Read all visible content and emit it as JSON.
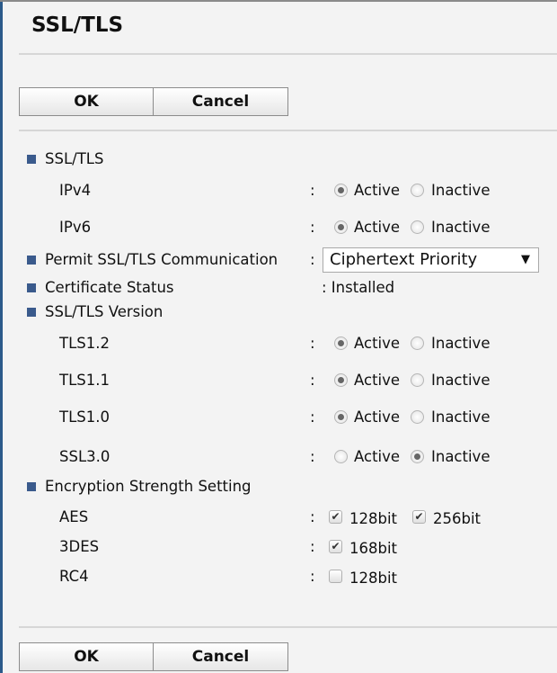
{
  "title": "SSL/TLS",
  "buttons": {
    "ok": "OK",
    "cancel": "Cancel"
  },
  "colon": ":",
  "options": {
    "active": "Active",
    "inactive": "Inactive"
  },
  "sections": {
    "ssltls": {
      "label": "SSL/TLS",
      "ipv4": {
        "label": "IPv4",
        "value": "Active"
      },
      "ipv6": {
        "label": "IPv6",
        "value": "Active"
      }
    },
    "permit": {
      "label": "Permit SSL/TLS Communication",
      "value": "Ciphertext Priority",
      "arrow": "▼"
    },
    "cert": {
      "label": "Certificate Status",
      "value": ": Installed"
    },
    "version": {
      "label": "SSL/TLS Version",
      "tls12": {
        "label": "TLS1.2",
        "value": "Active"
      },
      "tls11": {
        "label": "TLS1.1",
        "value": "Active"
      },
      "tls10": {
        "label": "TLS1.0",
        "value": "Active"
      },
      "ssl30": {
        "label": "SSL3.0",
        "value": "Inactive"
      }
    },
    "encryption": {
      "label": "Encryption Strength Setting",
      "aes": {
        "label": "AES",
        "opt1": "128bit",
        "opt1_checked": true,
        "opt2": "256bit",
        "opt2_checked": true
      },
      "des3": {
        "label": "3DES",
        "opt1": "168bit",
        "opt1_checked": true
      },
      "rc4": {
        "label": "RC4",
        "opt1": "128bit",
        "opt1_checked": false
      }
    }
  },
  "colors": {
    "bullet": "#3a5a8c",
    "background": "#f3f3f3"
  }
}
